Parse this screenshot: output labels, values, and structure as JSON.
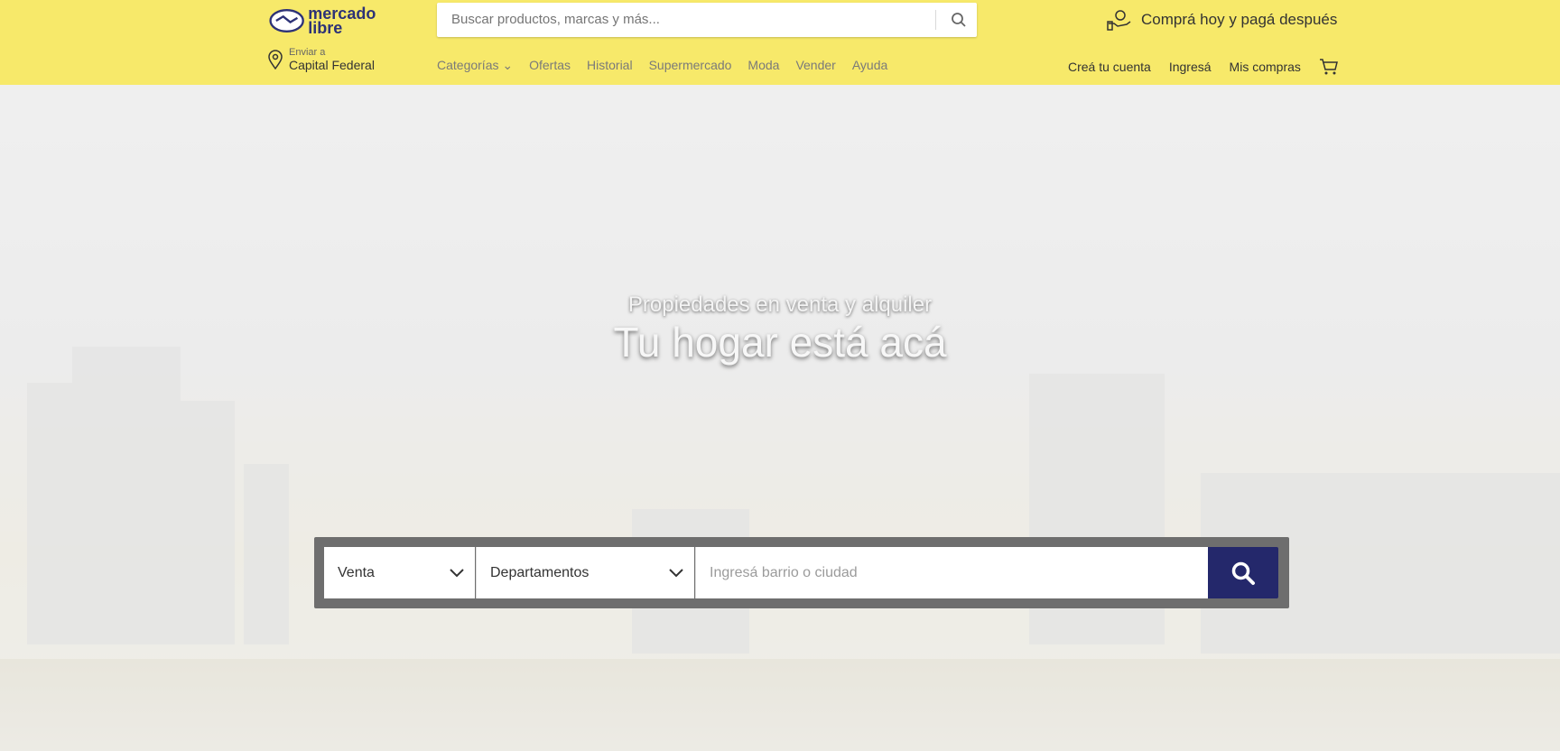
{
  "header": {
    "logo_text": "mercado libre",
    "search_placeholder": "Buscar productos, marcas y más...",
    "promo_text": "Comprá hoy y pagá después",
    "location_small": "Enviar a",
    "location_main": "Capital Federal",
    "nav": [
      "Categorías",
      "Ofertas",
      "Historial",
      "Supermercado",
      "Moda",
      "Vender",
      "Ayuda"
    ],
    "user_nav": [
      "Creá tu cuenta",
      "Ingresá",
      "Mis compras"
    ]
  },
  "hero": {
    "subtitle": "Propiedades en venta y alquiler",
    "title": "Tu hogar está acá"
  },
  "filters": {
    "operation": "Venta",
    "property_type": "Departamentos",
    "location_placeholder": "Ingresá barrio o ciudad"
  },
  "colors": {
    "header_bg": "#f7e96a",
    "search_button_bg": "#24286b"
  }
}
